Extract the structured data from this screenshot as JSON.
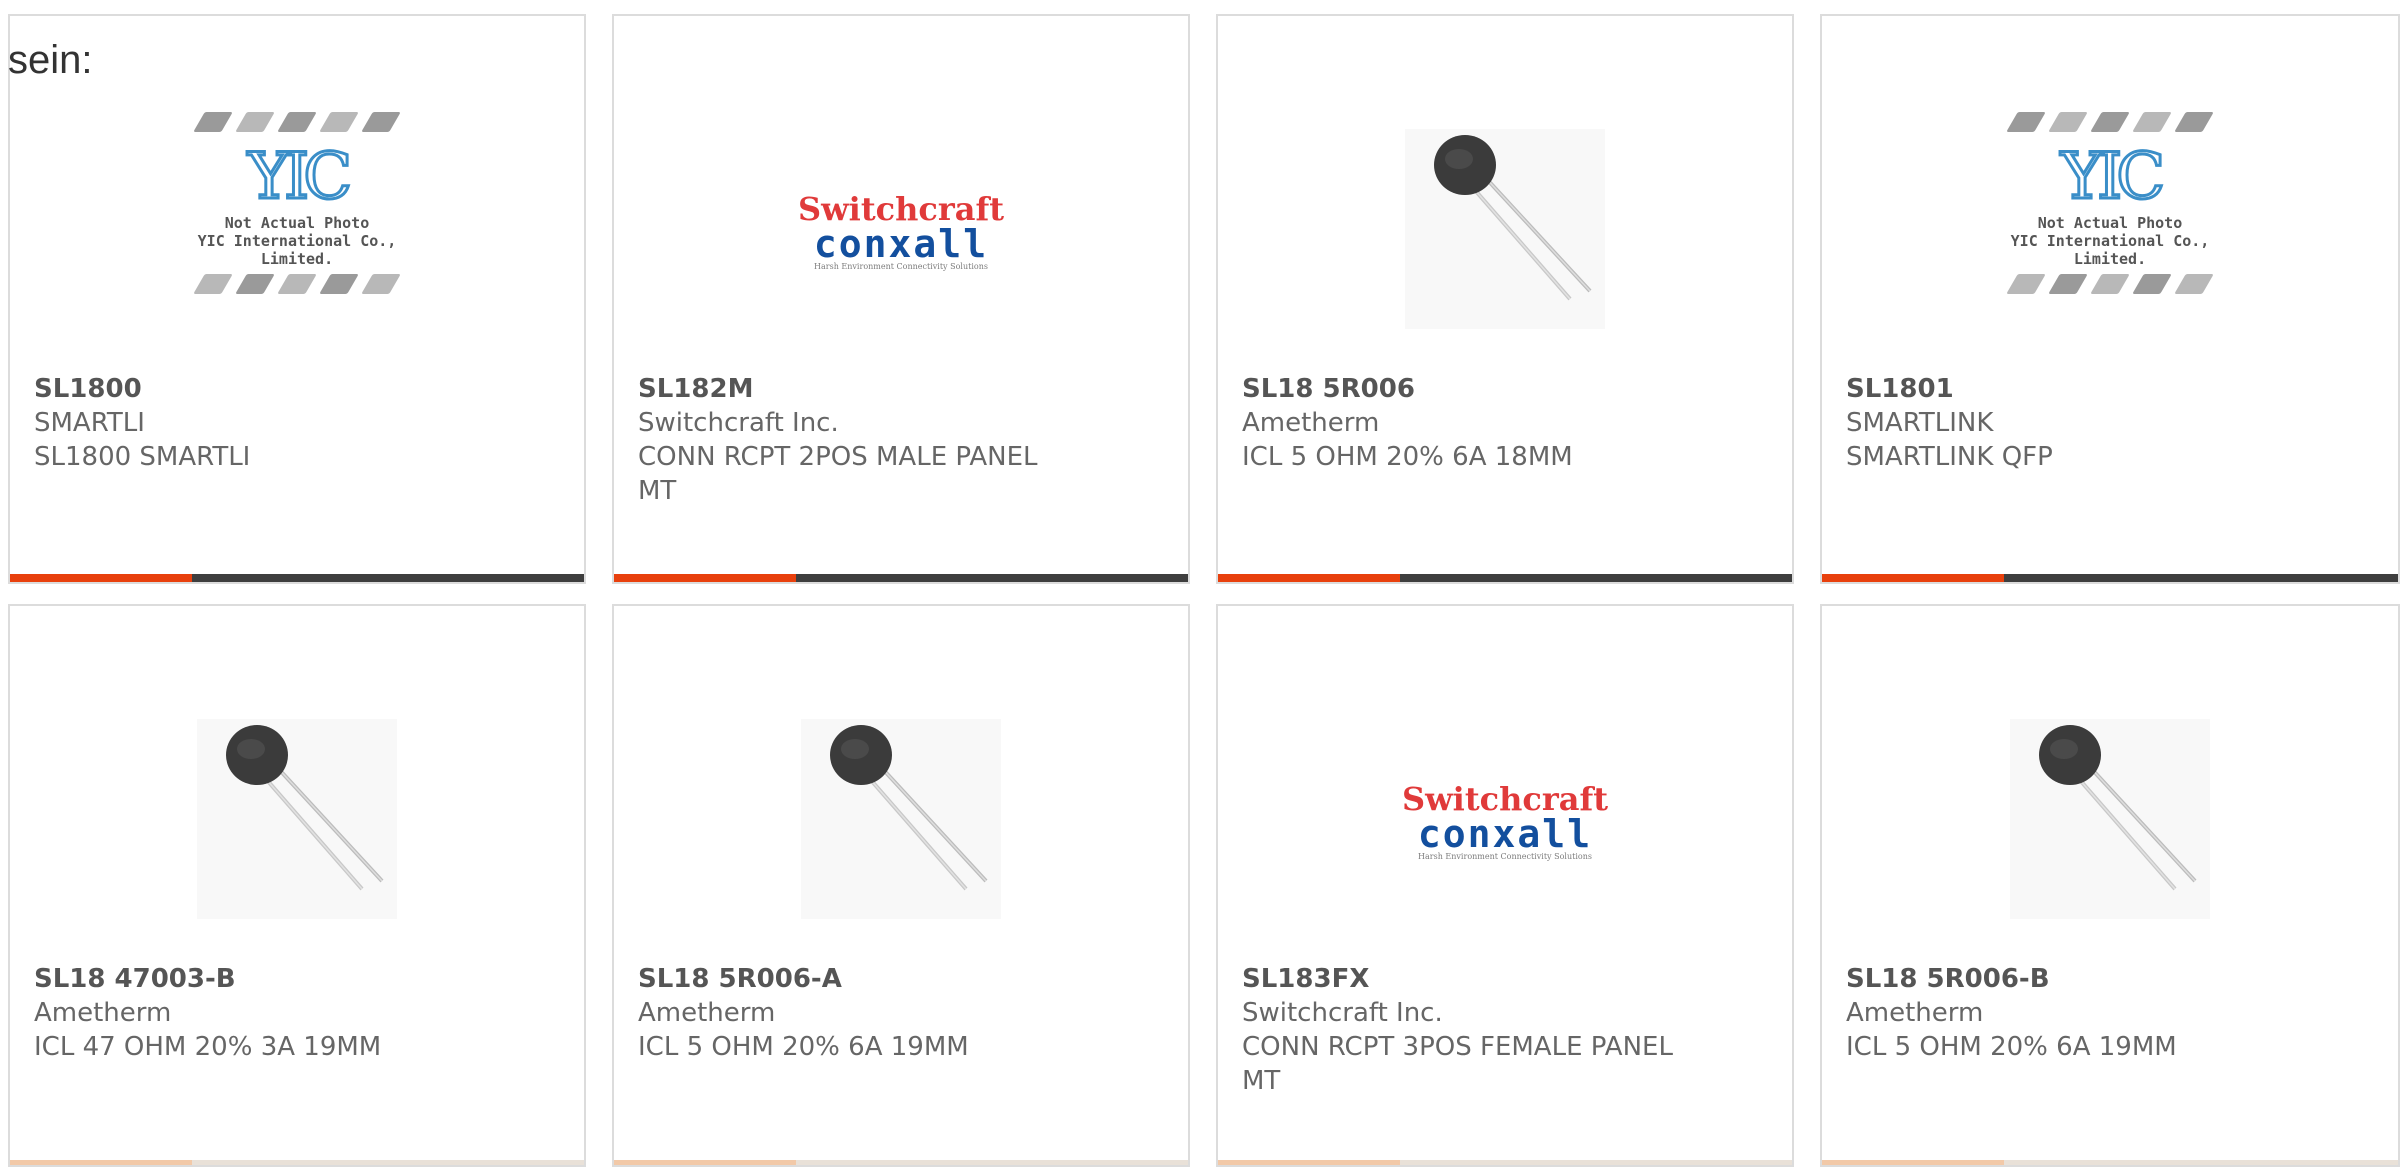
{
  "lead_text": "sein:",
  "cards": [
    {
      "pn": "SL1800",
      "mfr": "SMARTLI",
      "desc": "SL1800 SMARTLI",
      "image": "yic-placeholder"
    },
    {
      "pn": "SL182M",
      "mfr": "Switchcraft Inc.",
      "desc": "CONN RCPT 2POS MALE PANEL MT",
      "image": "switchcraft-logo"
    },
    {
      "pn": "SL18 5R006",
      "mfr": "Ametherm",
      "desc": "ICL 5 OHM 20% 6A 18MM",
      "image": "thermistor"
    },
    {
      "pn": "SL1801",
      "mfr": "SMARTLINK",
      "desc": "SMARTLINK QFP",
      "image": "yic-placeholder"
    },
    {
      "pn": "SL18 47003-B",
      "mfr": "Ametherm",
      "desc": "ICL 47 OHM 20% 3A 19MM",
      "image": "thermistor"
    },
    {
      "pn": "SL18 5R006-A",
      "mfr": "Ametherm",
      "desc": "ICL 5 OHM 20% 6A 19MM",
      "image": "thermistor"
    },
    {
      "pn": "SL183FX",
      "mfr": "Switchcraft Inc.",
      "desc": "CONN RCPT 3POS FEMALE PANEL MT",
      "image": "switchcraft-logo"
    },
    {
      "pn": "SL18 5R006-B",
      "mfr": "Ametherm",
      "desc": "ICL 5 OHM 20% 6A 19MM",
      "image": "thermistor"
    }
  ],
  "placeholder": {
    "logo_text": "YIC",
    "caption_line1": "Not Actual Photo",
    "caption_line2": "YIC International Co., Limited."
  },
  "switchcraft": {
    "line1": "Switchcraft",
    "line2": "conxall",
    "tagline": "Harsh Environment Connectivity Solutions"
  },
  "colors": {
    "accent": "#e8400d",
    "bar_dark": "#3e3e3e",
    "switchcraft_red": "#e03a3a",
    "conxall_blue": "#134f9e"
  }
}
